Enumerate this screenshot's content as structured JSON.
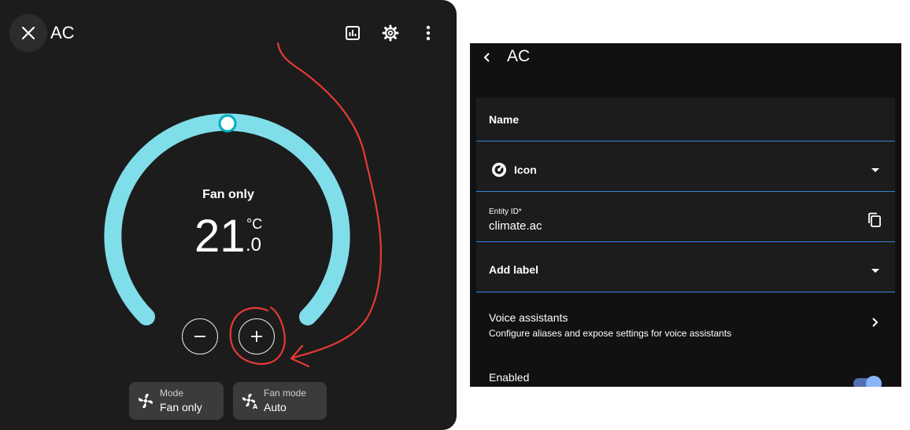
{
  "dialog": {
    "title": "AC",
    "mode_label": "Fan only",
    "temperature": {
      "whole": "21",
      "unit": "°C",
      "decimal": ".0"
    },
    "chips": [
      {
        "name": "Mode",
        "value": "Fan only",
        "icon": "fan-icon"
      },
      {
        "name": "Fan mode",
        "value": "Auto",
        "icon": "fan-auto-icon"
      }
    ],
    "header_icons": [
      "history-chart-icon",
      "settings-gear-icon",
      "more-vertical-icon"
    ],
    "colors": {
      "dial": "#80deea",
      "dial_handle": "#00acc1",
      "annotation": "#e53935"
    }
  },
  "settings": {
    "title": "AC",
    "fields": {
      "name_label": "Name",
      "icon_label": "Icon",
      "entity_id_label": "Entity ID*",
      "entity_id_value": "climate.ac",
      "add_label": "Add label"
    },
    "voice": {
      "title": "Voice assistants",
      "subtitle": "Configure aliases and expose settings for voice assistants"
    },
    "enabled_label": "Enabled",
    "accent": "#2f88d8"
  }
}
